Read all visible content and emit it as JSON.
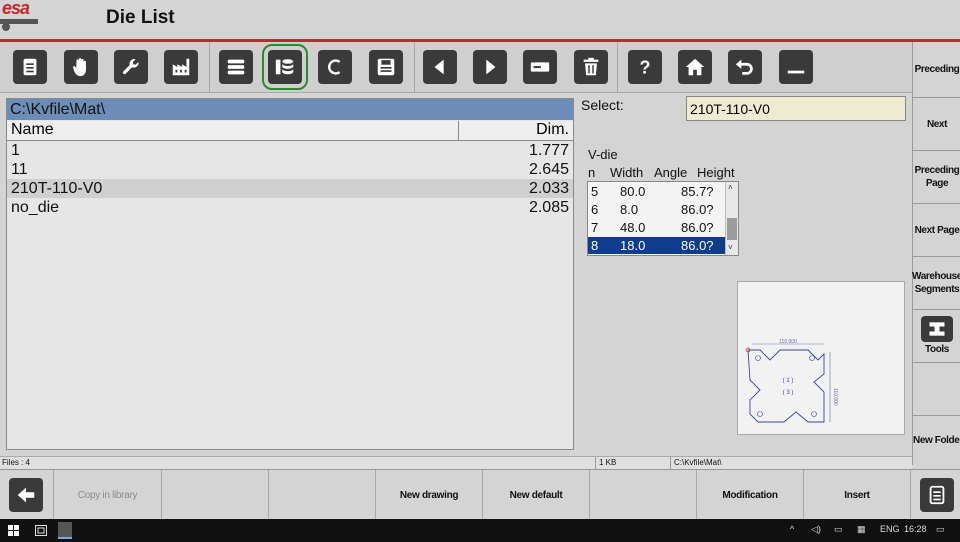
{
  "header": {
    "logo_text": "esa",
    "title": "Die List"
  },
  "toolbar": {
    "buttons": [
      {
        "name": "document-icon"
      },
      {
        "name": "hand-icon"
      },
      {
        "name": "wrench-icon"
      },
      {
        "name": "factory-icon"
      },
      {
        "name": "database-icon"
      },
      {
        "name": "die-list-icon",
        "active": true
      },
      {
        "name": "c-icon",
        "glyph": "C"
      },
      {
        "name": "save-icon"
      },
      {
        "name": "arrow-left-icon"
      },
      {
        "name": "arrow-right-icon"
      },
      {
        "name": "minus-icon"
      },
      {
        "name": "trash-icon"
      },
      {
        "name": "help-icon",
        "glyph": "?"
      },
      {
        "name": "home-icon"
      },
      {
        "name": "undo-icon"
      },
      {
        "name": "minimize-icon"
      }
    ],
    "active_color": "#2b8a2b"
  },
  "sidebar": {
    "items": [
      {
        "label": "Preceding"
      },
      {
        "label": "Next"
      },
      {
        "label": "Preceding Page"
      },
      {
        "label": "Next Page"
      },
      {
        "label": "Warehouse Segments"
      },
      {
        "label": "Tools"
      },
      {
        "label": ""
      },
      {
        "label": "New Folder"
      }
    ]
  },
  "file_list": {
    "path": "C:\\Kvfile\\Mat\\",
    "columns": {
      "name": "Name",
      "dim": "Dim."
    },
    "rows": [
      {
        "name": "1",
        "dim": "1.777"
      },
      {
        "name": "11",
        "dim": "2.645"
      },
      {
        "name": "210T-110-V0",
        "dim": "2.033",
        "selected": true
      },
      {
        "name": "no_die",
        "dim": "2.085"
      }
    ]
  },
  "select": {
    "label": "Select:",
    "value": "210T-110-V0"
  },
  "vdie": {
    "label": "V-die",
    "columns": {
      "n": "n",
      "width": "Width",
      "angle": "Angle",
      "height": "Height"
    },
    "rows": [
      {
        "n": "5",
        "width": "80.0",
        "angle": "85.7?"
      },
      {
        "n": "6",
        "width": "8.0",
        "angle": "86.0?"
      },
      {
        "n": "7",
        "width": "48.0",
        "angle": "86.0?"
      },
      {
        "n": "8",
        "width": "18.0",
        "angle": "86.0?",
        "selected": true
      }
    ],
    "scroll_up": "˄",
    "scroll_down": "˅"
  },
  "preview": {
    "dim_top": "110.000",
    "dim_side": "110.000"
  },
  "status": {
    "files": "Files : 4",
    "size": "1 KB",
    "path": "C:\\Kvfile\\Mat\\"
  },
  "bottom": {
    "buttons": [
      {
        "label": "",
        "kind": "back"
      },
      {
        "label": "Copy in library",
        "disabled": true
      },
      {
        "label": ""
      },
      {
        "label": "New drawing"
      },
      {
        "label": "New default"
      },
      {
        "label": ""
      },
      {
        "label": "Modification"
      },
      {
        "label": "Insert"
      },
      {
        "label": "",
        "kind": "menu"
      }
    ]
  },
  "taskbar": {
    "lang": "ENG",
    "time": "16:28"
  },
  "colors": {
    "accent_red": "#c0282c",
    "path_bar": "#6b8db8",
    "selection": "#0f3d8c",
    "select_field": "#efebd0"
  }
}
